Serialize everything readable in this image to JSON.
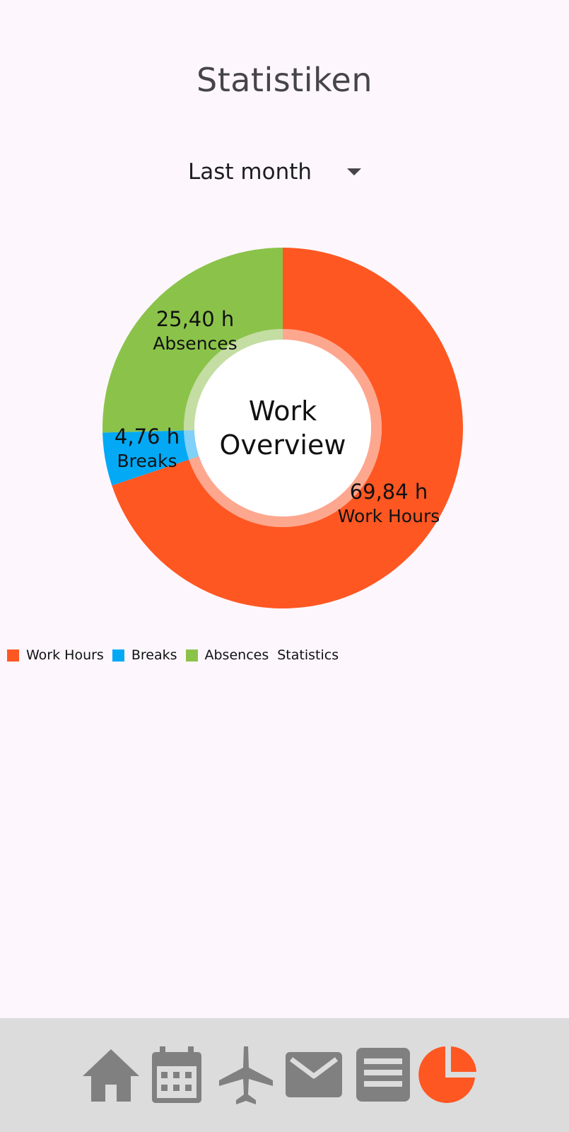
{
  "header": {
    "title": "Statistiken"
  },
  "period": {
    "selected": "Last month"
  },
  "chart_data": {
    "type": "pie",
    "title": "Work Overview",
    "title_lines": [
      "Work",
      "Overview"
    ],
    "unit": "h",
    "categories": [
      "Work Hours",
      "Breaks",
      "Absences"
    ],
    "values": [
      69.84,
      4.76,
      25.4
    ],
    "value_labels": [
      "69,84 h",
      "4,76 h",
      "25,40 h"
    ],
    "colors": [
      "#ff5722",
      "#03a9f4",
      "#8bc34a"
    ],
    "legend_position": "bottom-left",
    "legend_entries": [
      "Work Hours",
      "Breaks",
      "Absences"
    ],
    "legend_suffix": "Statistics"
  },
  "nav": {
    "items": [
      {
        "icon": "home-icon",
        "active": false
      },
      {
        "icon": "calendar-icon",
        "active": false
      },
      {
        "icon": "airplane-icon",
        "active": false
      },
      {
        "icon": "mail-icon",
        "active": false
      },
      {
        "icon": "list-icon",
        "active": false
      },
      {
        "icon": "pie-chart-icon",
        "active": true
      }
    ],
    "icon_color": "#808080",
    "active_color": "#ff5722"
  }
}
